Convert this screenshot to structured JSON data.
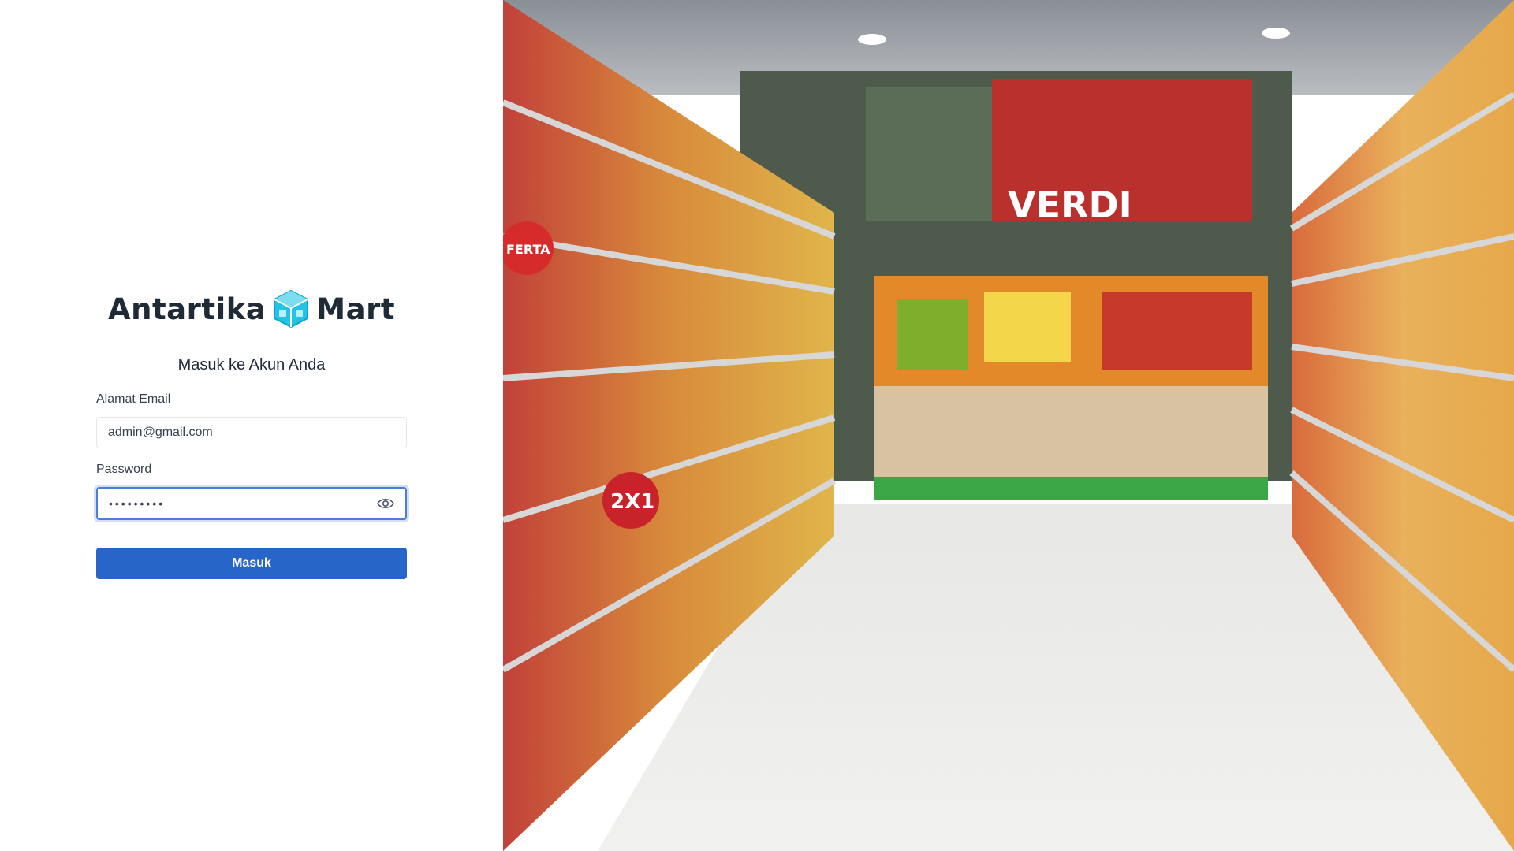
{
  "brand": {
    "word_left": "Antartika",
    "word_right": "Mart",
    "logo_icon": "cube-logo-icon"
  },
  "form": {
    "heading": "Masuk ke Akun Anda",
    "email_label": "Alamat Email",
    "email_value": "admin@gmail.com",
    "password_label": "Password",
    "password_value": "•••••••••",
    "toggle_icon": "eye-icon",
    "submit_label": "Masuk"
  },
  "hero": {
    "banner_text": "VERDI",
    "badge_left": "FERTA",
    "badge_center": "2X1"
  },
  "colors": {
    "primary": "#2865c9",
    "accent_top": "#2f6fd1",
    "brand_text": "#1f2a37",
    "logo": "#22c3e6"
  }
}
